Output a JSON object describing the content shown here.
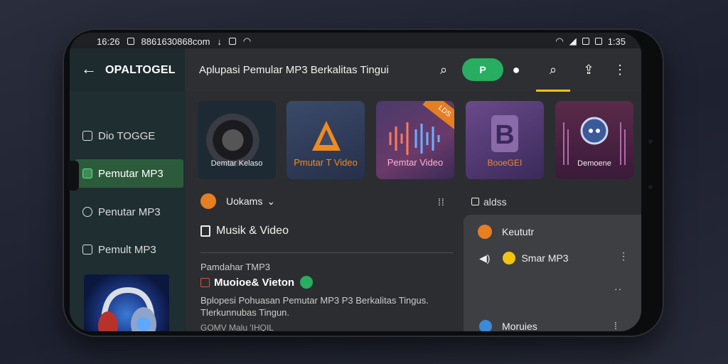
{
  "status": {
    "time": "16:26",
    "url": "8861630868com",
    "battery_time": "1:35"
  },
  "app": {
    "title": "OPALTOGEL",
    "header_title": "Aplupasi Pemular MP3 Berkalitas Tingui",
    "p_button": "P"
  },
  "sidebar": {
    "items": [
      {
        "label": "Dio TOGGE"
      },
      {
        "label": "Pemutar MP3"
      },
      {
        "label": "Penutar MP3"
      },
      {
        "label": "Pemult MP3"
      }
    ]
  },
  "tiles": [
    {
      "label": "Demtar Kelaso"
    },
    {
      "label": "Pmutar T Video"
    },
    {
      "label": "Pemtar Video",
      "badge": "LDS"
    },
    {
      "label": "BooeGEI"
    },
    {
      "label": "Demoene"
    }
  ],
  "content": {
    "selector": "Uokams",
    "section_title": "Musik & Video",
    "small_label": "Pamdahar TMP3",
    "bold_title": "Muoioe& Vieton",
    "description": "Bplopesi Pohuasan Pemutar MP3 P3 Berkalitas Tingus. Tlerkunnubas Tingun.",
    "footer": "GOMV Malu 'IHQIL"
  },
  "right": {
    "label": "aldss",
    "items": [
      {
        "label": "Keututr"
      },
      {
        "label": "Smar MP3"
      },
      {
        "label": "Moruies"
      }
    ]
  },
  "colors": {
    "accent_green": "#27ae60",
    "accent_orange": "#e67e22",
    "underline": "#f1c40f"
  }
}
